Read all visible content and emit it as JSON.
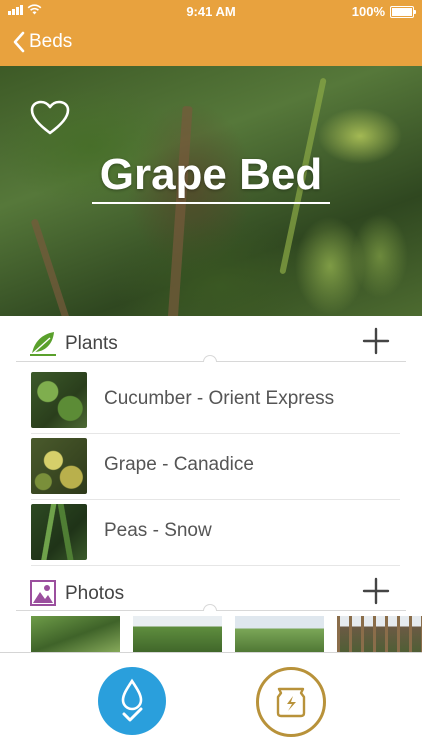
{
  "status_bar": {
    "time": "9:41 AM",
    "battery": "100%"
  },
  "nav": {
    "back_label": "Beds"
  },
  "bed": {
    "title": "Grape Bed"
  },
  "plants_section": {
    "label": "Plants",
    "items": [
      {
        "name": "Cucumber - Orient Express"
      },
      {
        "name": "Grape - Canadice"
      },
      {
        "name": "Peas - Snow"
      }
    ]
  },
  "photos_section": {
    "label": "Photos"
  },
  "colors": {
    "accent": "#e8a23e",
    "water": "#2a9fdc",
    "fertilize": "#b8923a",
    "plants_icon": "#5aa02c",
    "photos_icon": "#9b4f9e"
  }
}
